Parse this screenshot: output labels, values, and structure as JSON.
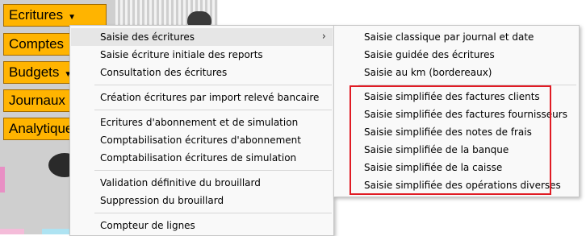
{
  "sidebar": {
    "buttons": [
      {
        "label": "Ecritures",
        "caret": "▼"
      },
      {
        "label": "Comptes",
        "caret": ""
      },
      {
        "label": "Budgets",
        "caret": "▼"
      },
      {
        "label": "Journaux",
        "caret": "▼"
      },
      {
        "label": "Analytique",
        "caret": ""
      }
    ]
  },
  "menu": {
    "items": [
      {
        "label": "Saisie des écritures",
        "has_submenu": true,
        "arrow": "›"
      },
      {
        "label": "Saisie écriture initiale des reports"
      },
      {
        "label": "Consultation des écritures"
      },
      {
        "label": "Création écritures par import relevé bancaire"
      },
      {
        "label": "Ecritures d'abonnement et de simulation"
      },
      {
        "label": "Comptabilisation écritures d'abonnement"
      },
      {
        "label": "Comptabilisation écritures de simulation"
      },
      {
        "label": "Validation définitive du brouillard"
      },
      {
        "label": "Suppression du brouillard"
      },
      {
        "label": "Compteur de lignes"
      }
    ]
  },
  "submenu": {
    "items": [
      {
        "label": "Saisie classique par journal et date"
      },
      {
        "label": "Saisie guidée des écritures"
      },
      {
        "label": "Saisie au km (bordereaux)"
      },
      {
        "label": "Saisie simplifiée des factures clients"
      },
      {
        "label": "Saisie simplifiée des factures fournisseurs"
      },
      {
        "label": "Saisie simplifiée des notes de frais"
      },
      {
        "label": "Saisie simplifiée de la banque"
      },
      {
        "label": "Saisie simplifiée de la caisse"
      },
      {
        "label": "Saisie simplifiée des opérations diverses"
      }
    ]
  },
  "colors": {
    "sidebar_button": "#ffb400",
    "highlight_box": "#e01b24",
    "menu_background": "#f9f9f9",
    "hover": "#e6e6e6"
  }
}
